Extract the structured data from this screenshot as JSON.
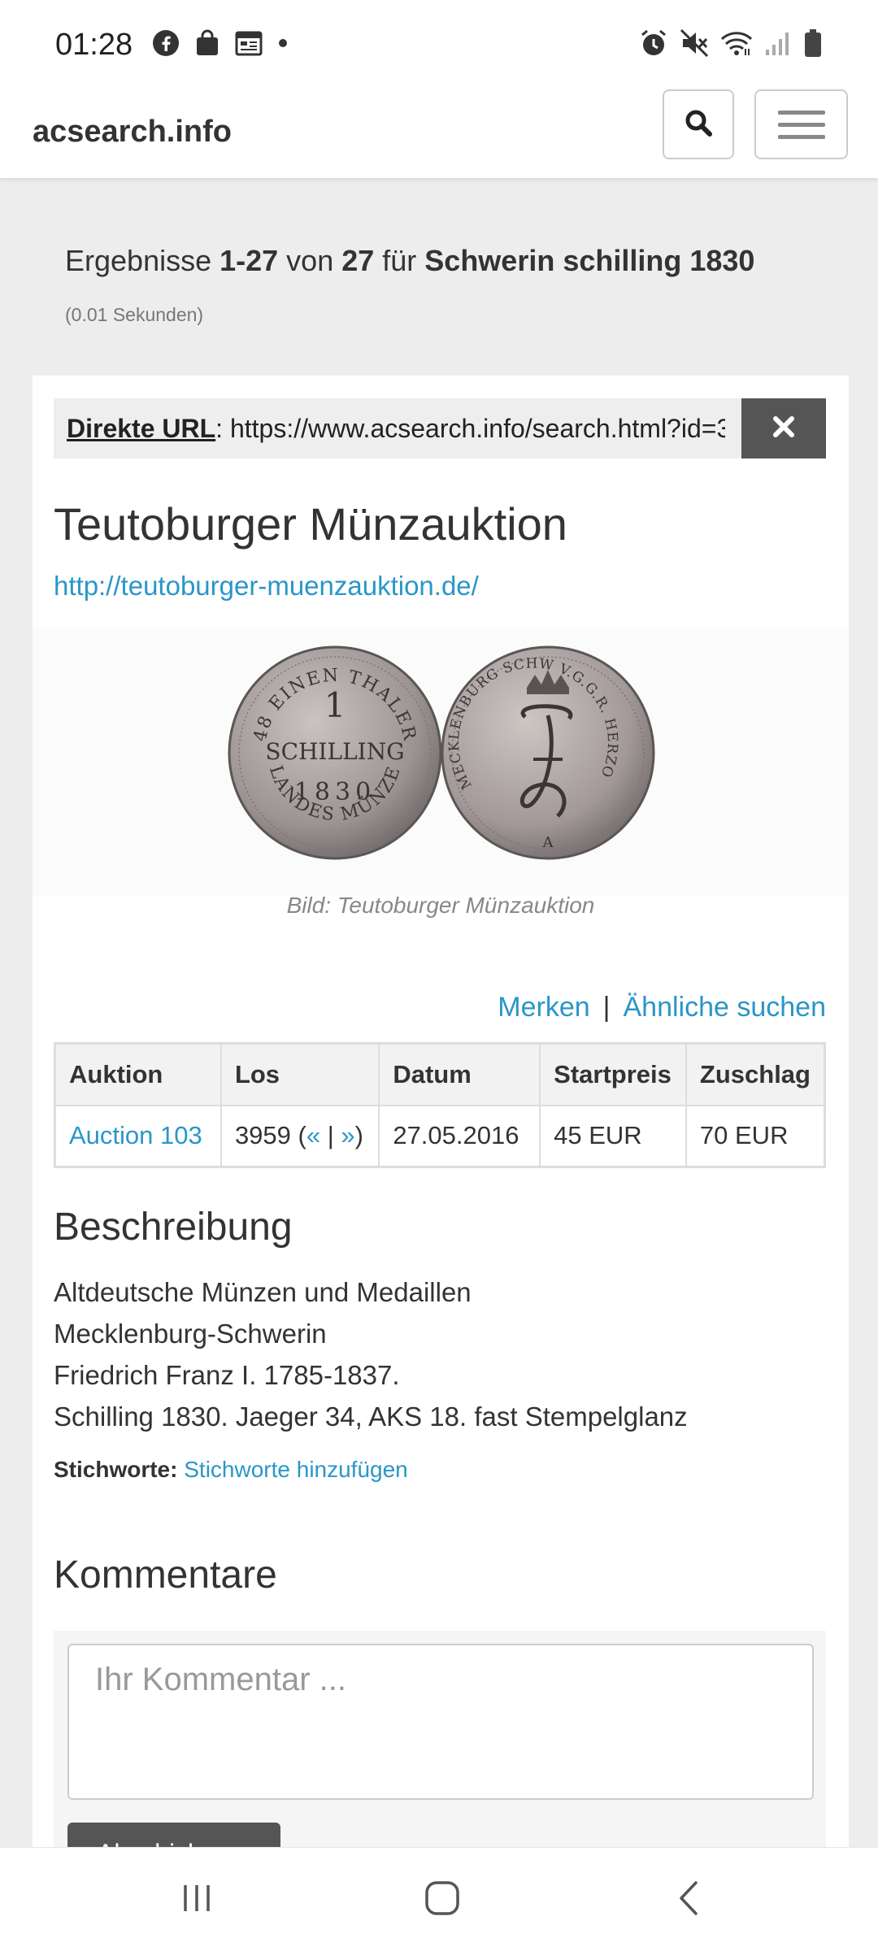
{
  "status_bar": {
    "time": "01:28",
    "left_icons": [
      "facebook-icon",
      "shopping-bag-icon",
      "calendar-icon",
      "dot-icon"
    ],
    "right_icons": [
      "alarm-icon",
      "mute-icon",
      "wifi-icon",
      "signal-icon",
      "battery-icon"
    ]
  },
  "navbar": {
    "brand": "acsearch.info",
    "search_icon": "search-icon",
    "menu_icon": "hamburger-menu-icon"
  },
  "results": {
    "prefix": "Ergebnisse ",
    "range": "1-27",
    "of": " von ",
    "total": "27",
    "for": " für ",
    "query": "Schwerin schilling 1830",
    "timing": "(0.01 Sekunden)"
  },
  "direct_url": {
    "label": "Direkte URL",
    "colon": ": ",
    "value": "https://www.acsearch.info/search.html?id=3",
    "close_icon": "close-icon"
  },
  "auction_house": {
    "name": "Teutoburger Münzauktion",
    "url": "http://teutoburger-muenzauktion.de/"
  },
  "coin": {
    "obverse_text_top": "48 EINEN THALER",
    "obverse_center": [
      "1",
      "SCHILLING",
      "1830"
    ],
    "obverse_text_bottom": "LANDES MÜNZE",
    "reverse_text": "MECKLENBURG SCHW V.G.G.R. HERZOG",
    "reverse_mint": "A",
    "caption": "Bild: Teutoburger Münzauktion"
  },
  "actions": {
    "bookmark": "Merken",
    "separator": "|",
    "similar": "Ähnliche suchen"
  },
  "lot_table": {
    "headers": [
      "Auktion",
      "Los",
      "Datum",
      "Startpreis",
      "Zuschlag"
    ],
    "row": {
      "auction": "Auction 103",
      "lot_number": "3959",
      "lot_open": " (",
      "prev": "«",
      "lot_sep": " | ",
      "next": "»",
      "lot_close": ")",
      "date": "27.05.2016",
      "start_price": "45 EUR",
      "hammer_price": "70 EUR"
    }
  },
  "description": {
    "title": "Beschreibung",
    "lines": [
      "Altdeutsche Münzen und Medaillen",
      "Mecklenburg-Schwerin",
      "Friedrich Franz I. 1785-1837.",
      "Schilling 1830. Jaeger 34, AKS 18. fast Stempelglanz"
    ],
    "tags_label": "Stichworte:",
    "tags_link": "Stichworte hinzufügen"
  },
  "comments": {
    "title": "Kommentare",
    "placeholder": "Ihr Kommentar ...",
    "submit": "Abschicken"
  },
  "bottom_nav": {
    "recents_icon": "recents-icon",
    "home_icon": "home-icon",
    "back_icon": "back-icon"
  }
}
